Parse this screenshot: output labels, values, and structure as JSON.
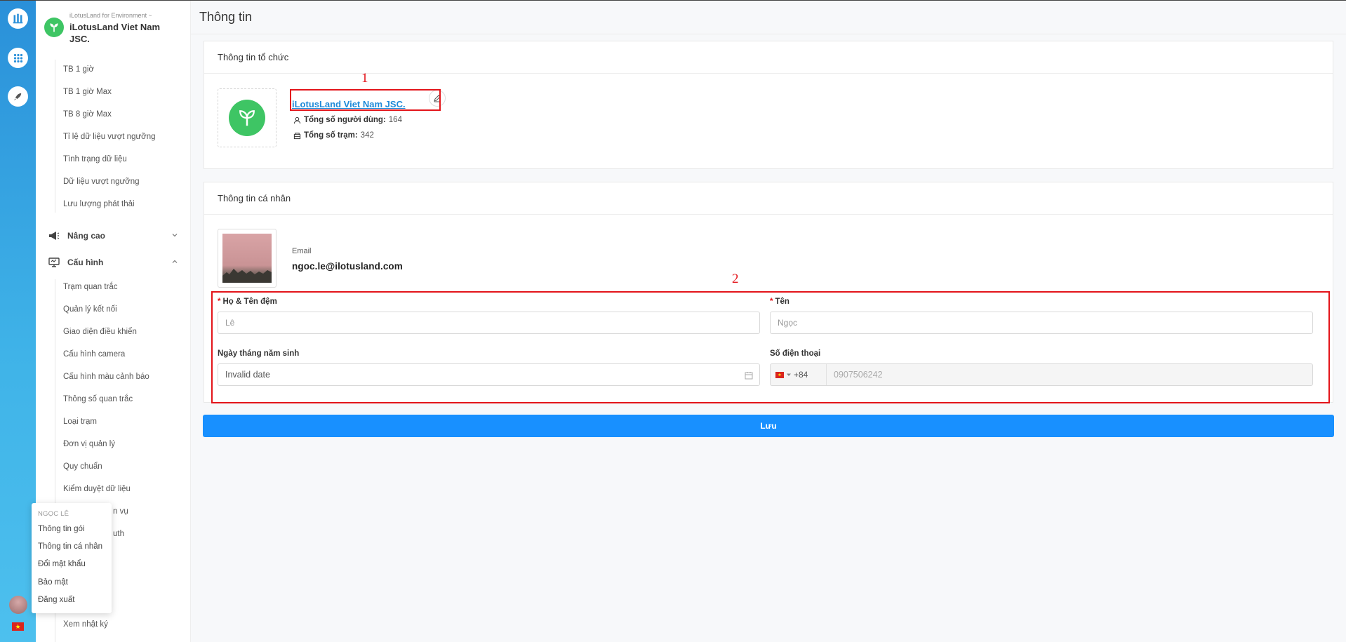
{
  "org": {
    "subtitle": "iLotusLand for Environment",
    "subtitle_mark": "~",
    "name": "iLotusLand Viet Nam JSC."
  },
  "sidebar": {
    "group1_items": [
      "TB 1 giờ",
      "TB 1 giờ Max",
      "TB 8 giờ Max",
      "Tỉ lệ dữ liệu vượt ngưỡng",
      "Tình trạng dữ liệu",
      "Dữ liệu vượt ngưỡng",
      "Lưu lượng phát thải"
    ],
    "group_advanced": "Nâng cao",
    "group_config": "Cấu hình",
    "config_items": [
      "Trạm quan trắc",
      "Quản lý kết nối",
      "Giao diện điều khiển",
      "Cấu hình camera",
      "Cấu hình màu cảnh báo",
      "Thông số quan trắc",
      "Loại trạm",
      "Đơn vị quản lý",
      "Quy chuẩn",
      "Kiểm duyệt dữ liệu"
    ],
    "partial_item_1": "n vụ",
    "partial_item_2": "uth",
    "last_item": "Xem nhật ký"
  },
  "user_menu": {
    "title": "NGỌC LÊ",
    "items": [
      "Thông tin gói",
      "Thông tin cá nhân",
      "Đổi mật khẩu",
      "Bảo mật",
      "Đăng xuất"
    ]
  },
  "page": {
    "title": "Thông tin"
  },
  "org_card": {
    "title": "Thông tin tổ chức",
    "org_name": "iLotusLand Viet Nam JSC.",
    "users_label": "Tổng số người dùng:",
    "users_value": "164",
    "stations_label": "Tổng số trạm:",
    "stations_value": "342"
  },
  "personal_card": {
    "title": "Thông tin cá nhân",
    "email_label": "Email",
    "email_value": "ngoc.le@ilotusland.com",
    "lastname_label": "Họ & Tên đệm",
    "lastname_value": "Lê",
    "firstname_label": "Tên",
    "firstname_value": "Ngọc",
    "birthday_label": "Ngày tháng năm sinh",
    "birthday_value": "Invalid date",
    "phone_label": "Số điện thoại",
    "phone_code": "+84",
    "phone_value": "0907506242",
    "required_mark": "*"
  },
  "annotations": {
    "label_1": "1",
    "label_2": "2"
  },
  "actions": {
    "save_label": "Lưu"
  },
  "colors": {
    "primary": "#1890ff",
    "link": "#1e8ad8",
    "brand_green": "#3ec564",
    "annotation_red": "#e3141a"
  }
}
